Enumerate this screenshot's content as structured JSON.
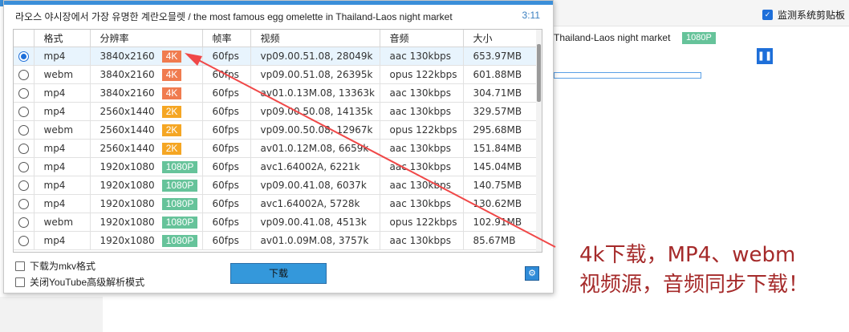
{
  "background_app": {
    "monitor_clipboard_label": "监测系统剪贴板",
    "video_title_fragment": "Thailand-Laos night market",
    "resolution_badge": "1080P",
    "pause_glyph": "❚❚"
  },
  "dialog": {
    "title": "라오스 야시장에서 가장 유명한 계란오믈렛  / the most famous egg omelette in Thailand-Laos night market",
    "time": "3:11",
    "columns": [
      "格式",
      "分辨率",
      "帧率",
      "视频",
      "音频",
      "大小"
    ],
    "rows": [
      {
        "selected": true,
        "format": "mp4",
        "resolution": "3840x2160",
        "badge": "4K",
        "badge_color": "#f07b4f",
        "fps": "60fps",
        "video": "vp09.00.51.08, 28049k",
        "audio": "aac 130kbps",
        "size": "653.97MB"
      },
      {
        "selected": false,
        "format": "webm",
        "resolution": "3840x2160",
        "badge": "4K",
        "badge_color": "#f07b4f",
        "fps": "60fps",
        "video": "vp09.00.51.08, 26395k",
        "audio": "opus 122kbps",
        "size": "601.88MB"
      },
      {
        "selected": false,
        "format": "mp4",
        "resolution": "3840x2160",
        "badge": "4K",
        "badge_color": "#f07b4f",
        "fps": "60fps",
        "video": "av01.0.13M.08, 13363k",
        "audio": "aac 130kbps",
        "size": "304.71MB"
      },
      {
        "selected": false,
        "format": "mp4",
        "resolution": "2560x1440",
        "badge": "2K",
        "badge_color": "#f5a623",
        "fps": "60fps",
        "video": "vp09.00.50.08, 14135k",
        "audio": "aac 130kbps",
        "size": "329.57MB"
      },
      {
        "selected": false,
        "format": "webm",
        "resolution": "2560x1440",
        "badge": "2K",
        "badge_color": "#f5a623",
        "fps": "60fps",
        "video": "vp09.00.50.08, 12967k",
        "audio": "opus 122kbps",
        "size": "295.68MB"
      },
      {
        "selected": false,
        "format": "mp4",
        "resolution": "2560x1440",
        "badge": "2K",
        "badge_color": "#f5a623",
        "fps": "60fps",
        "video": "av01.0.12M.08, 6659k",
        "audio": "aac 130kbps",
        "size": "151.84MB"
      },
      {
        "selected": false,
        "format": "mp4",
        "resolution": "1920x1080",
        "badge": "1080P",
        "badge_color": "#66c39a",
        "fps": "60fps",
        "video": "avc1.64002A, 6221k",
        "audio": "aac 130kbps",
        "size": "145.04MB"
      },
      {
        "selected": false,
        "format": "mp4",
        "resolution": "1920x1080",
        "badge": "1080P",
        "badge_color": "#66c39a",
        "fps": "60fps",
        "video": "vp09.00.41.08, 6037k",
        "audio": "aac 130kbps",
        "size": "140.75MB"
      },
      {
        "selected": false,
        "format": "mp4",
        "resolution": "1920x1080",
        "badge": "1080P",
        "badge_color": "#66c39a",
        "fps": "60fps",
        "video": "avc1.64002A, 5728k",
        "audio": "aac 130kbps",
        "size": "130.62MB"
      },
      {
        "selected": false,
        "format": "webm",
        "resolution": "1920x1080",
        "badge": "1080P",
        "badge_color": "#66c39a",
        "fps": "60fps",
        "video": "vp09.00.41.08, 4513k",
        "audio": "opus 122kbps",
        "size": "102.91MB"
      },
      {
        "selected": false,
        "format": "mp4",
        "resolution": "1920x1080",
        "badge": "1080P",
        "badge_color": "#66c39a",
        "fps": "60fps",
        "video": "av01.0.09M.08, 3757k",
        "audio": "aac 130kbps",
        "size": "85.67MB"
      }
    ],
    "options": {
      "mkv_label": "下载为mkv格式",
      "youtube_mode_label": "关闭YouTube高级解析模式"
    },
    "download_button": "下载",
    "settings_icon": "gear-icon"
  },
  "annotation": {
    "line1": "4k下载，MP4、webm",
    "line2": "视频源，音频同步下载！",
    "color": "#a52a2a",
    "arrow_color": "#f04848"
  }
}
